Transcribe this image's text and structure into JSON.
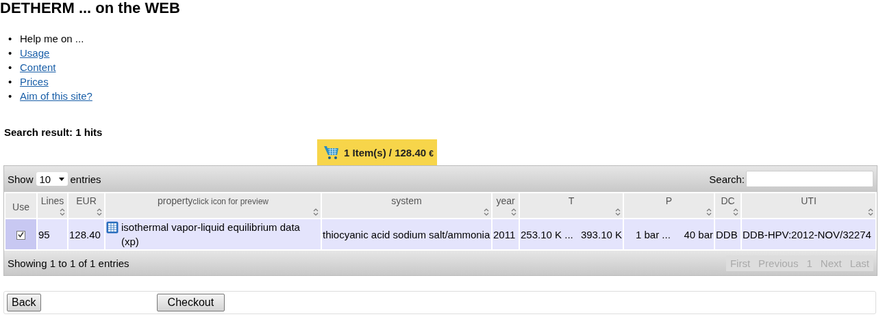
{
  "title": "DETHERM ... on the WEB",
  "help_menu": [
    {
      "bullet": "•",
      "label": "Help me on ...",
      "kind": "text"
    },
    {
      "bullet": "•",
      "label": "Usage",
      "kind": "link"
    },
    {
      "bullet": "•",
      "label": "Content",
      "kind": "link"
    },
    {
      "bullet": "•",
      "label": "Prices",
      "kind": "link"
    },
    {
      "bullet": "•",
      "label": "Aim of this site?",
      "kind": "link"
    }
  ],
  "result_heading": "Search result: 1 hits",
  "cart": {
    "label": "1 Item(s) / 128.40",
    "currency": "€"
  },
  "table": {
    "length_label_before": "Show",
    "length_value": "10",
    "length_label_after": "entries",
    "search_label": "Search:",
    "columns": [
      {
        "label": "Use",
        "sortable": false
      },
      {
        "label": "Lines",
        "sortable": true
      },
      {
        "label": "EUR",
        "sortable": true
      },
      {
        "label": "property",
        "note": "click icon for preview",
        "sortable": true
      },
      {
        "label": "system",
        "sortable": true
      },
      {
        "label": "year",
        "sortable": true
      },
      {
        "label": "T",
        "sortable": true
      },
      {
        "label": "P",
        "sortable": true
      },
      {
        "label": "DC",
        "sortable": true
      },
      {
        "label": "UTI",
        "sortable": true
      }
    ],
    "rows": [
      {
        "checked": true,
        "lines": "95",
        "eur": "128.40",
        "property": "isothermal vapor-liquid equilibrium data (xp)",
        "system": "thiocyanic acid sodium salt/ammonia",
        "year": "2011",
        "t_from": "253.10 K ...",
        "t_to": "393.10 K",
        "p_from": "1 bar ...",
        "p_to": "40 bar",
        "dc": "DDB",
        "uti": "DDB-HPV:2012-NOV/32274"
      }
    ],
    "info": "Showing 1 to 1 of 1 entries",
    "pagination": [
      {
        "label": "First",
        "disabled": true
      },
      {
        "label": "Previous",
        "disabled": true
      },
      {
        "label": "1",
        "disabled": true
      },
      {
        "label": "Next",
        "disabled": true
      },
      {
        "label": "Last",
        "disabled": true
      }
    ]
  },
  "buttons": [
    {
      "label": "Back"
    },
    {
      "label": "Checkout"
    }
  ]
}
